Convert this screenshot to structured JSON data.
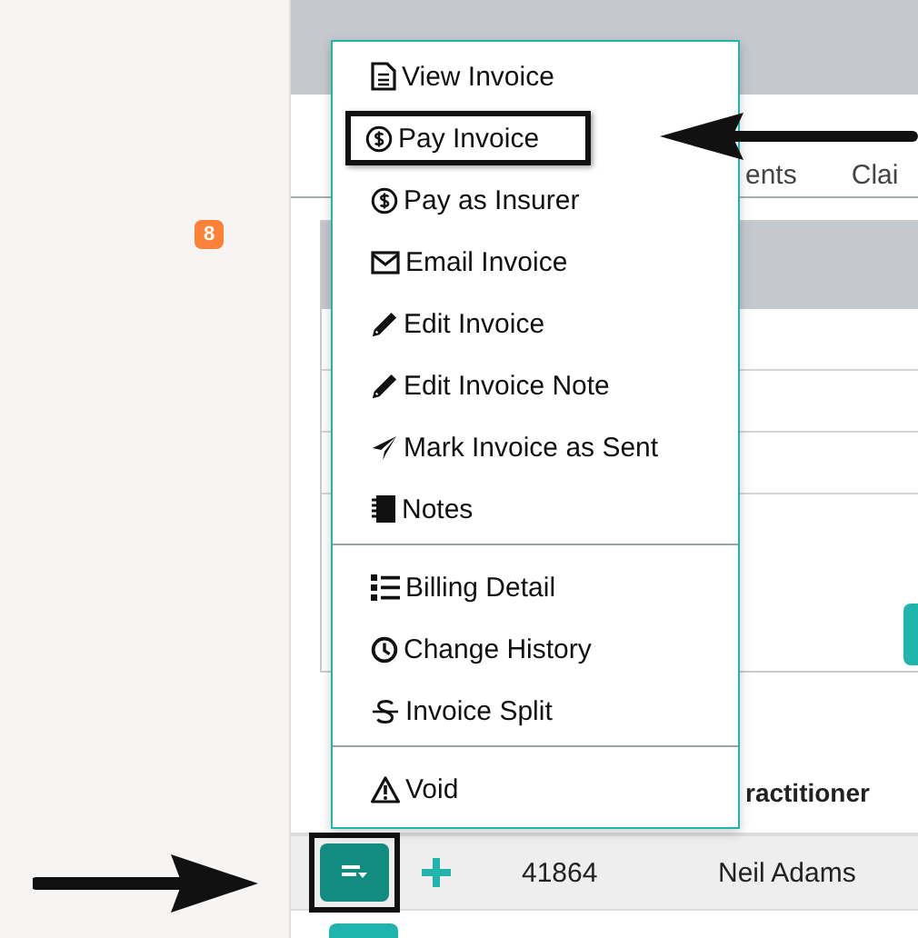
{
  "sidebar": {
    "badge": "8"
  },
  "tabs": [
    {
      "label": "ents"
    },
    {
      "label": "Clai"
    }
  ],
  "menu": {
    "groups": [
      [
        {
          "label": "View Invoice",
          "kind": "document",
          "highlighted": false
        },
        {
          "label": "Pay Invoice",
          "kind": "dollar",
          "highlighted": true
        },
        {
          "label": "Pay as Insurer",
          "kind": "dollar",
          "highlighted": false
        },
        {
          "label": "Email Invoice",
          "kind": "envelope",
          "highlighted": false
        },
        {
          "label": "Edit Invoice",
          "kind": "pencil",
          "highlighted": false
        },
        {
          "label": "Edit Invoice Note",
          "kind": "pencil",
          "highlighted": false
        },
        {
          "label": "Mark Invoice as Sent",
          "kind": "plane",
          "highlighted": false
        },
        {
          "label": "Notes",
          "kind": "notebook",
          "highlighted": false
        }
      ],
      [
        {
          "label": "Billing Detail",
          "kind": "list",
          "highlighted": false
        },
        {
          "label": "Change History",
          "kind": "clock",
          "highlighted": false
        },
        {
          "label": "Invoice Split",
          "kind": "strike",
          "highlighted": false
        }
      ],
      [
        {
          "label": "Void",
          "kind": "warning",
          "highlighted": false
        }
      ]
    ]
  },
  "table": {
    "columns": [
      {
        "label": "ractitioner"
      }
    ],
    "rows": [
      {
        "number": "41864",
        "practitioner": "Neil Adams",
        "highlighted": true
      }
    ]
  }
}
